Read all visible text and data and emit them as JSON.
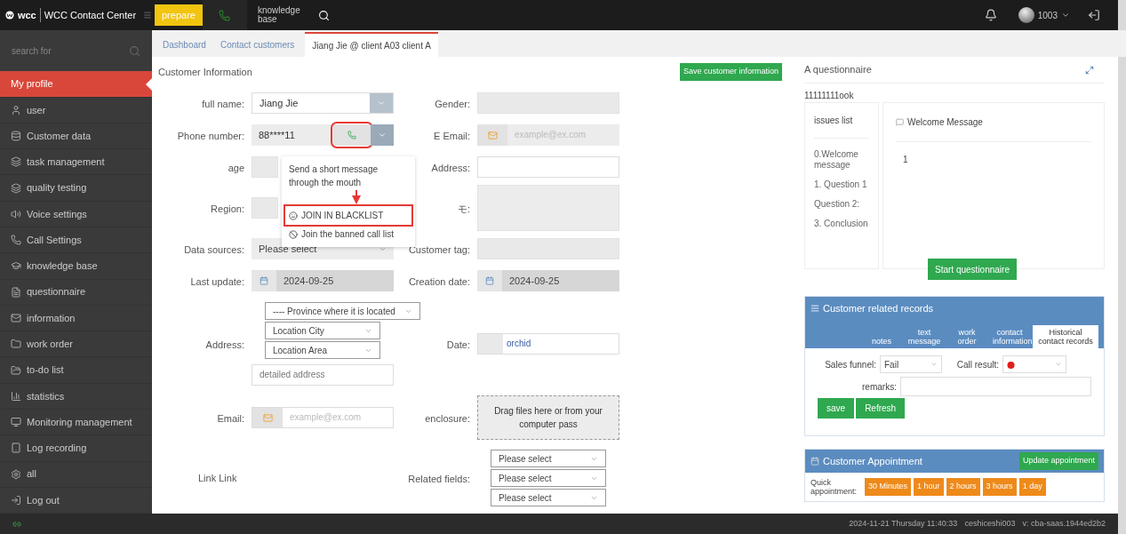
{
  "topbar": {
    "logo": "wcc",
    "title": "WCC Contact Center",
    "prepare_button": "prepare",
    "knowledge_link": "knowledge base",
    "user": "1003"
  },
  "sidebar": {
    "search_placeholder": "search for",
    "items": [
      {
        "label": "My profile",
        "selected": true
      },
      {
        "label": "user",
        "selected": false
      },
      {
        "label": "Customer data",
        "selected": false
      },
      {
        "label": "task management",
        "selected": false
      },
      {
        "label": "quality testing",
        "selected": false
      },
      {
        "label": "Voice settings",
        "selected": false
      },
      {
        "label": "Call Settings",
        "selected": false
      },
      {
        "label": "knowledge base",
        "selected": false
      },
      {
        "label": "questionnaire",
        "selected": false
      },
      {
        "label": "information",
        "selected": false
      },
      {
        "label": "work order",
        "selected": false
      },
      {
        "label": "to-do list",
        "selected": false
      },
      {
        "label": "statistics",
        "selected": false
      },
      {
        "label": "Monitoring management",
        "selected": false
      },
      {
        "label": "Log recording",
        "selected": false
      },
      {
        "label": "all",
        "selected": false
      },
      {
        "label": "Log out",
        "selected": false
      }
    ]
  },
  "tabs": [
    {
      "label": "Dashboard",
      "selected": false
    },
    {
      "label": "Contact customers",
      "selected": false
    },
    {
      "label": "Jiang Jie @ client A03 client A",
      "selected": true
    }
  ],
  "customer_info": {
    "title": "Customer Information",
    "save_button": "Save customer information",
    "full_name": {
      "label": "full name:",
      "value": "Jiang Jie"
    },
    "gender": {
      "label": "Gender:"
    },
    "phone": {
      "label": "Phone number:",
      "value": "88****11",
      "call_highlighted": true
    },
    "e_email": {
      "label": "E Email:",
      "placeholder": "example@ex.com"
    },
    "age": {
      "label": "age"
    },
    "address": {
      "label": "Address:"
    },
    "region": {
      "label": "Region:"
    },
    "memo": {
      "label": "モ:"
    },
    "data_sources": {
      "label": "Data sources:",
      "value": "Please select"
    },
    "customer_tag": {
      "label": "Customer tag:"
    },
    "last_update": {
      "label": "Last update:",
      "value": "2024-09-25"
    },
    "creation_date": {
      "label": "Creation date:",
      "value": "2024-09-25"
    },
    "location": {
      "label": "Address:",
      "selects": [
        "---- Province where it is located",
        "Location City",
        "Location Area"
      ],
      "detail_placeholder": "detailed address"
    },
    "date": {
      "label": "Date:",
      "value": "orchid"
    },
    "email": {
      "label": "Email:",
      "placeholder": "example@ex.com"
    },
    "enclosure": {
      "label": "enclosure:",
      "dropzone": "Drag files here or from your computer pass"
    },
    "link": {
      "label": "Link Link"
    },
    "related_fields": {
      "label": "Related fields:",
      "selects": [
        "Please select",
        "Please select",
        "Please select"
      ]
    },
    "phone_menu": [
      {
        "label": "Send a short message through the mouth",
        "highlighted": false
      },
      {
        "label": "JOIN IN BLACKLIST",
        "highlighted": true
      },
      {
        "label": "Join the banned call list",
        "highlighted": false
      }
    ]
  },
  "questionnaire": {
    "title": "A questionnaire",
    "code": "11111111ook",
    "issues_title": "issues list",
    "message_title": "Welcome Message",
    "answer": "1",
    "start_button": "Start questionnaire",
    "questions": [
      "0.Welcome message",
      "1. Question 1",
      "Question 2:",
      "3. Conclusion"
    ]
  },
  "records": {
    "title": "Customer related records",
    "tabs": [
      {
        "label": "notes",
        "selected": false
      },
      {
        "label": "text message",
        "selected": false
      },
      {
        "label": "work order",
        "selected": false
      },
      {
        "label": "contact information",
        "selected": false
      },
      {
        "label": "Historical contact records",
        "selected": true
      }
    ],
    "sales_funnel": {
      "label": "Sales funnel:",
      "value": "Fail"
    },
    "call_result": {
      "label": "Call result:"
    },
    "remarks": {
      "label": "remarks:"
    },
    "buttons": [
      "save",
      "Refresh"
    ]
  },
  "appointment": {
    "title": "Customer Appointment",
    "update_button": "Update appointment",
    "quick_label": "Quick appointment:",
    "options": [
      "30 Minutes",
      "1 hour",
      "2 hours",
      "3 hours",
      "1 day"
    ]
  },
  "status_bar": {
    "datetime": "2024-11-21 Thursday 11:40:33",
    "user": "ceshiceshi003",
    "version": "v: cba-saas.1944ed2b2"
  }
}
